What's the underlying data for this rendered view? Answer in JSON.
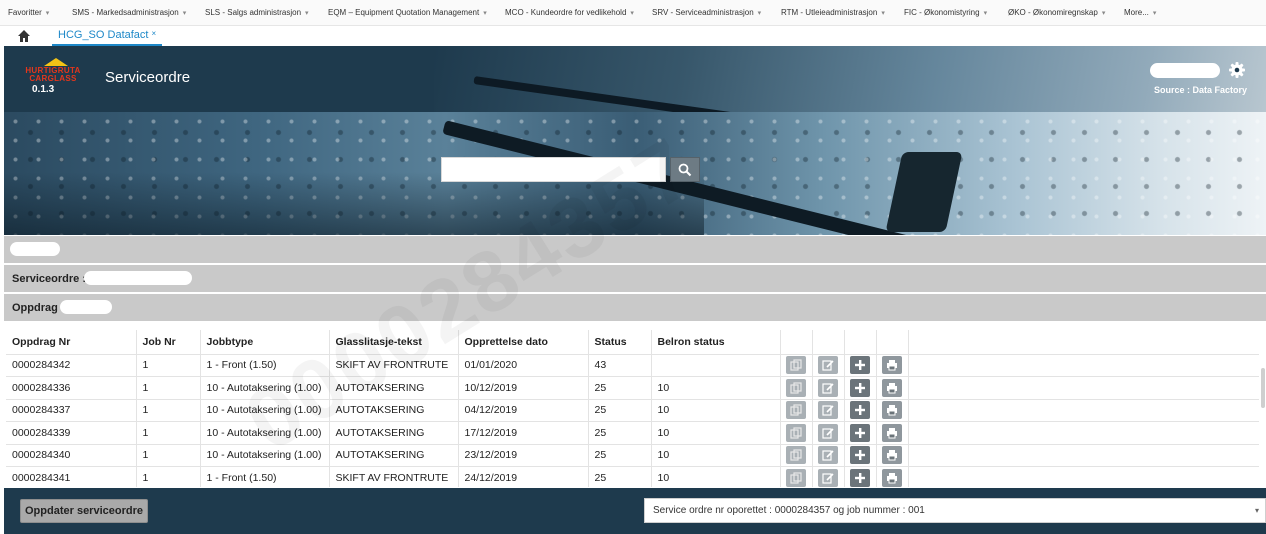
{
  "menu": [
    {
      "label": "Favoritter"
    },
    {
      "label": "SMS - Markedsadministrasjon"
    },
    {
      "label": "SLS - Salgs administrasjon"
    },
    {
      "label": "EQM – Equipment Quotation Management"
    },
    {
      "label": "MCO - Kundeordre for vedlikehold"
    },
    {
      "label": "SRV - Serviceadministrasjon"
    },
    {
      "label": "RTM - Utleieadministrasjon"
    },
    {
      "label": "FIC - Økonomistyring"
    },
    {
      "label": "ØKO - Økonomiregnskap"
    },
    {
      "label": "More..."
    }
  ],
  "tab": {
    "label": "HCG_SO Datafact",
    "close": "×"
  },
  "header": {
    "logo_line1": "HURTIGRUTA",
    "logo_line2": "CARGLASS",
    "version": "0.1.3",
    "title": "Serviceordre",
    "source": "Source : Data Factory"
  },
  "search": {
    "placeholder": ""
  },
  "info": {
    "serviceordre_label": "Serviceordre :",
    "oppdrag_label": "Oppdrag :"
  },
  "table": {
    "headers": [
      "Oppdrag Nr",
      "Job Nr",
      "Jobbtype",
      "Glasslitasje-tekst",
      "Opprettelse dato",
      "Status",
      "Belron status"
    ],
    "rows": [
      [
        "0000284342",
        "1",
        "1 - Front (1.50)",
        "SKIFT AV FRONTRUTE",
        "01/01/2020",
        "43",
        ""
      ],
      [
        "0000284336",
        "1",
        "10 - Autotaksering (1.00)",
        "AUTOTAKSERING",
        "10/12/2019",
        "25",
        "10"
      ],
      [
        "0000284337",
        "1",
        "10 - Autotaksering (1.00)",
        "AUTOTAKSERING",
        "04/12/2019",
        "25",
        "10"
      ],
      [
        "0000284339",
        "1",
        "10 - Autotaksering (1.00)",
        "AUTOTAKSERING",
        "17/12/2019",
        "25",
        "10"
      ],
      [
        "0000284340",
        "1",
        "10 - Autotaksering (1.00)",
        "AUTOTAKSERING",
        "23/12/2019",
        "25",
        "10"
      ],
      [
        "0000284341",
        "1",
        "1 - Front (1.50)",
        "SKIFT AV FRONTRUTE",
        "24/12/2019",
        "25",
        "10"
      ]
    ],
    "row_actions": [
      "copy-icon",
      "edit-icon",
      "plus-icon",
      "print-icon"
    ]
  },
  "watermark": "0000284357",
  "footer": {
    "update_button": "Oppdater serviceordre",
    "status_text": "Service ordre nr oporettet : 0000284357 og job nummer : 001"
  },
  "colors": {
    "header_bg": "#1e3a4d",
    "tab_accent": "#1e88c8",
    "logo_red": "#e4361c",
    "logo_yellow": "#f3c316",
    "strip_bg": "#c9c9c9"
  }
}
